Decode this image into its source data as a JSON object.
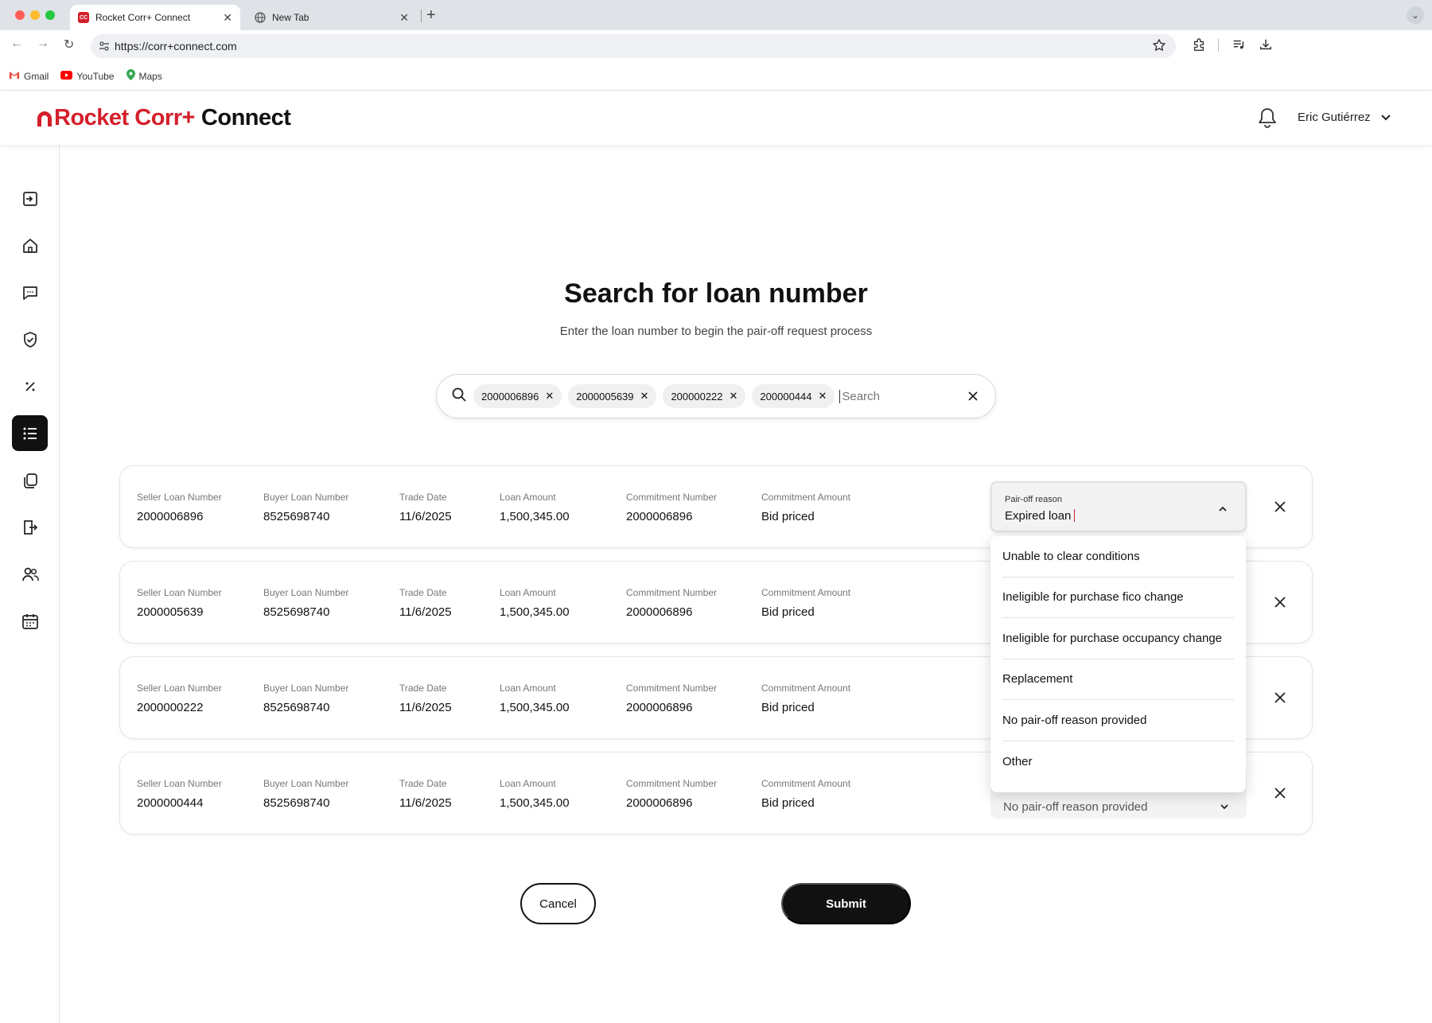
{
  "browser": {
    "tabs": [
      {
        "title": "Rocket Corr+ Connect",
        "favicon_text": "CC",
        "active": true
      },
      {
        "title": "New Tab",
        "active": false
      }
    ],
    "url": "https://corr+connect.com",
    "bookmarks": [
      "Gmail",
      "YouTube",
      "Maps"
    ]
  },
  "header": {
    "logo_primary": "Rocket Corr+",
    "logo_secondary": "Connect",
    "user_name": "Eric Gutiérrez"
  },
  "sidebar": {
    "items": [
      {
        "icon": "sign-in-icon",
        "active": false
      },
      {
        "icon": "home-icon",
        "active": false
      },
      {
        "icon": "message-icon",
        "active": false
      },
      {
        "icon": "shield-check-icon",
        "active": false
      },
      {
        "icon": "percent-icon",
        "active": false
      },
      {
        "icon": "list-icon",
        "active": true
      },
      {
        "icon": "documents-icon",
        "active": false
      },
      {
        "icon": "door-exit-icon",
        "active": false
      },
      {
        "icon": "users-icon",
        "active": false
      },
      {
        "icon": "calendar-icon",
        "active": false
      }
    ]
  },
  "main": {
    "title": "Search for loan number",
    "subtitle": "Enter the loan number to begin the pair-off request process",
    "search": {
      "chips": [
        "2000006896",
        "2000005639",
        "200000222",
        "200000444"
      ],
      "placeholder": "Search"
    },
    "labels": {
      "seller": "Seller Loan Number",
      "buyer": "Buyer Loan Number",
      "trade_date": "Trade Date",
      "loan_amount": "Loan Amount",
      "commitment_number": "Commitment Number",
      "commitment_amount": "Commitment Amount",
      "pair_off_reason": "Pair-off reason"
    },
    "loans": [
      {
        "seller": "2000006896",
        "buyer": "8525698740",
        "trade_date": "11/6/2025",
        "loan_amount": "1,500,345.00",
        "commitment_number": "2000006896",
        "commitment_amount": "Bid priced",
        "reason": "Expired loan"
      },
      {
        "seller": "2000005639",
        "buyer": "8525698740",
        "trade_date": "11/6/2025",
        "loan_amount": "1,500,345.00",
        "commitment_number": "2000006896",
        "commitment_amount": "Bid priced",
        "reason": ""
      },
      {
        "seller": "2000000222",
        "buyer": "8525698740",
        "trade_date": "11/6/2025",
        "loan_amount": "1,500,345.00",
        "commitment_number": "2000006896",
        "commitment_amount": "Bid priced",
        "reason": ""
      },
      {
        "seller": "2000000444",
        "buyer": "8525698740",
        "trade_date": "11/6/2025",
        "loan_amount": "1,500,345.00",
        "commitment_number": "2000006896",
        "commitment_amount": "Bid priced",
        "reason": "No pair-off reason provided"
      }
    ],
    "reason_options": [
      "Unable to clear conditions",
      "Ineligible for purchase fico change",
      "Ineligible for purchase occupancy change",
      "Replacement",
      "No pair-off reason provided",
      "Other"
    ],
    "cancel_label": "Cancel",
    "submit_label": "Submit"
  },
  "colors": {
    "brand_red": "#d4202b",
    "primary_dark": "#111111"
  }
}
